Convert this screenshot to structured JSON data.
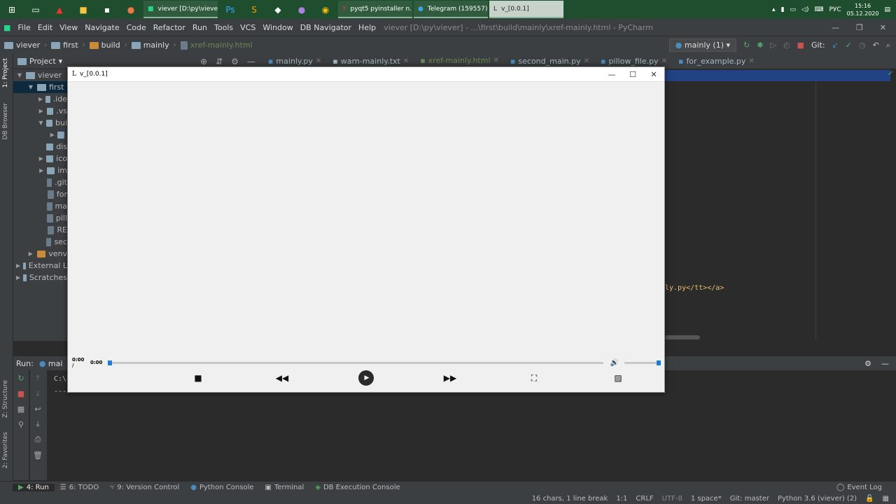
{
  "taskbar": {
    "windows": [
      {
        "label": "viever [D:\\py\\viever]...",
        "active": false
      },
      {
        "label": "pyqt5 pyinstaller n...",
        "active": false
      },
      {
        "label": "Telegram (159557)",
        "active": false
      },
      {
        "label": "v_[0.0.1]",
        "active": true
      }
    ],
    "lang": "РУС",
    "time": "15:16",
    "date": "05.12.2020"
  },
  "menu": [
    "File",
    "Edit",
    "View",
    "Navigate",
    "Code",
    "Refactor",
    "Run",
    "Tools",
    "VCS",
    "Window",
    "DB Navigator",
    "Help"
  ],
  "window_title": "viever [D:\\py\\viever] - ...\\first\\build\\mainly\\xref-mainly.html - PyCharm",
  "breadcrumbs": [
    "viever",
    "first",
    "build",
    "mainly",
    "xref-mainly.html"
  ],
  "run_config": "mainly (1)",
  "git_label": "Git:",
  "project": {
    "title": "Project",
    "items": [
      {
        "label": "viever",
        "indent": 0,
        "arrow": "▼"
      },
      {
        "label": "first",
        "indent": 1,
        "arrow": "▼",
        "selected": true
      },
      {
        "label": ".ide",
        "indent": 2,
        "arrow": "▶"
      },
      {
        "label": ".vs",
        "indent": 2,
        "arrow": "▶"
      },
      {
        "label": "bui",
        "indent": 2,
        "arrow": "▼"
      },
      {
        "label": "",
        "indent": 3,
        "arrow": "▶"
      },
      {
        "label": "dis",
        "indent": 2,
        "arrow": ""
      },
      {
        "label": "ico",
        "indent": 2,
        "arrow": "▶"
      },
      {
        "label": "im",
        "indent": 2,
        "arrow": "▶"
      },
      {
        "label": ".git",
        "indent": 2,
        "arrow": ""
      },
      {
        "label": "for",
        "indent": 2,
        "arrow": ""
      },
      {
        "label": "ma",
        "indent": 2,
        "arrow": ""
      },
      {
        "label": "pill",
        "indent": 2,
        "arrow": ""
      },
      {
        "label": "RE",
        "indent": 2,
        "arrow": ""
      },
      {
        "label": "sec",
        "indent": 2,
        "arrow": ""
      },
      {
        "label": "venv",
        "indent": 1,
        "arrow": "▶"
      },
      {
        "label": "External L",
        "indent": 0,
        "arrow": "▶"
      },
      {
        "label": "Scratches",
        "indent": 0,
        "arrow": "▶"
      }
    ]
  },
  "tabs": [
    {
      "label": "mainly.py",
      "active": false
    },
    {
      "label": "warn-mainly.txt",
      "active": false
    },
    {
      "label": "xref-mainly.html",
      "active": true
    },
    {
      "label": "second_main.py",
      "active": false
    },
    {
      "label": "pillow_file.py",
      "active": false
    },
    {
      "label": "for_example.py",
      "active": false
    }
  ],
  "code_fragment": "ly.py</tt></a>",
  "left_strip": {
    "project": "1: Project",
    "db": "DB Browser",
    "structure": "Z: Structure",
    "favorites": "2: Favorites"
  },
  "run_panel": {
    "label": "Run:",
    "tab": "mai",
    "console": [
      "C:\\",
      "---"
    ]
  },
  "tool_windows": [
    "4: Run",
    "6: TODO",
    "9: Version Control",
    "Python Console",
    "Terminal",
    "DB Execution Console"
  ],
  "event_log": "Event Log",
  "status": [
    "16 chars, 1 line break",
    "1:1",
    "CRLF",
    "UTF-8",
    "1 space*",
    "Git: master",
    "Python 3.6 (viever) (2)"
  ],
  "player": {
    "title": "v_[0.0.1]",
    "time_current": "0:00 /",
    "time_total": "0:00",
    "seek_fraction": 0,
    "volume_fraction": 1
  }
}
